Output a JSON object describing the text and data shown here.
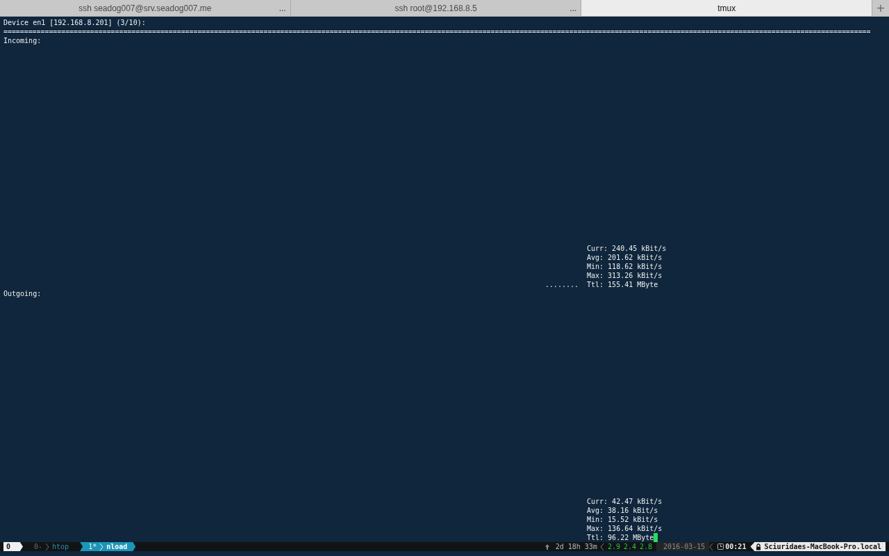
{
  "tabs": [
    {
      "title": "ssh seadog007@srv.seadog007.me",
      "more": "...",
      "selected": false
    },
    {
      "title": "ssh root@192.168.8.5",
      "more": "...",
      "selected": false
    },
    {
      "title": "tmux",
      "selected": true
    }
  ],
  "new_tab": "+",
  "terminal": {
    "header": "Device en1 [192.168.8.201] (3/10):",
    "separator": "==================================================================================================================================================================================================================",
    "sections": [
      {
        "label": "Incoming:",
        "graph": "........",
        "stats": [
          "Curr: 240.45 kBit/s",
          "Avg: 201.62 kBit/s",
          "Min: 118.62 kBit/s",
          "Max: 313.26 kBit/s",
          "Ttl: 155.41 MByte"
        ]
      },
      {
        "label": "Outgoing:",
        "stats": [
          "Curr: 42.47 kBit/s",
          "Avg: 38.16 kBit/s",
          "Min: 15.52 kBit/s",
          "Max: 136.64 kBit/s",
          "Ttl: 96.22 MByte"
        ],
        "cursor": true
      }
    ]
  },
  "status_bar": {
    "session": "0",
    "windows": [
      {
        "index": "0-",
        "name": "htop",
        "selected": false
      },
      {
        "index": "1*",
        "name": "nload",
        "selected": true
      }
    ],
    "uptime": "2d 18h 33m",
    "load": [
      "2.9",
      "2.4",
      "2.8"
    ],
    "date": "2016-03-15",
    "time": "00:21",
    "host": "Sciuridaes-MacBook-Pro.local"
  }
}
